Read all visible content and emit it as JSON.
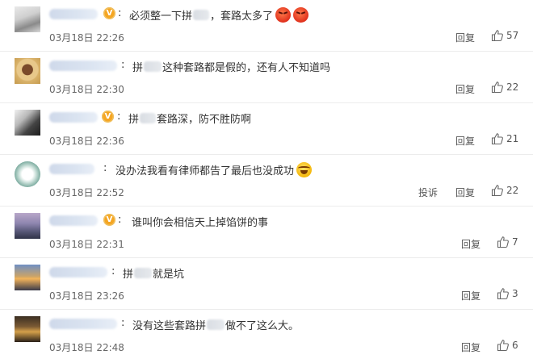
{
  "colors": {
    "badge": "#f5a623",
    "divider": "#ececec",
    "text": "#333333",
    "meta": "#666666"
  },
  "comments": [
    {
      "text_before": "必须整一下拼",
      "text_after": "，套路太多了",
      "emojis": [
        "angry-face-icon",
        "angry-face-icon"
      ],
      "verified": true,
      "time": "03月18日 22:26",
      "report": "",
      "reply": "回复",
      "likes": "57"
    },
    {
      "text_before": "拼",
      "text_after": "这种套路都是假的，还有人不知道吗",
      "emojis": [],
      "verified": false,
      "time": "03月18日 22:30",
      "report": "",
      "reply": "回复",
      "likes": "22"
    },
    {
      "text_before": "拼",
      "text_after": "套路深，防不胜防啊",
      "emojis": [],
      "verified": true,
      "time": "03月18日 22:36",
      "report": "",
      "reply": "回复",
      "likes": "21"
    },
    {
      "text_before": "没办法我看有律师都告了最后也没成功",
      "text_after": "",
      "emojis": [
        "laughing-face-icon"
      ],
      "verified": false,
      "time": "03月18日 22:52",
      "report": "投诉",
      "reply": "回复",
      "likes": "22"
    },
    {
      "text_before": "谁叫你会相信天上掉馅饼的事",
      "text_after": "",
      "emojis": [],
      "verified": true,
      "time": "03月18日 22:31",
      "report": "",
      "reply": "回复",
      "likes": "7"
    },
    {
      "text_before": "拼",
      "text_after": "就是坑",
      "emojis": [],
      "verified": false,
      "time": "03月18日 23:26",
      "report": "",
      "reply": "回复",
      "likes": "3"
    },
    {
      "text_before": "没有这些套路拼",
      "text_after": "做不了这么大。",
      "emojis": [],
      "verified": false,
      "time": "03月18日 22:48",
      "report": "",
      "reply": "回复",
      "likes": "6"
    }
  ]
}
